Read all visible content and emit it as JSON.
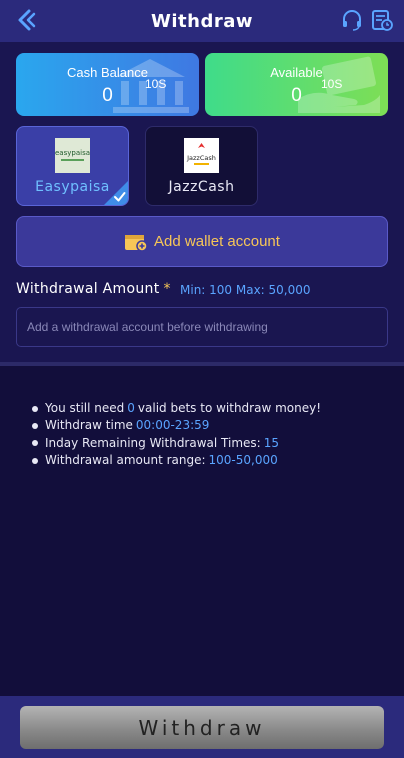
{
  "header": {
    "title": "Withdraw",
    "back_icon": "back-chevron-icon",
    "support_icon": "headset-icon",
    "records_icon": "records-icon"
  },
  "balances": {
    "cash": {
      "label": "Cash Balance",
      "value": "0",
      "amount": "10S"
    },
    "available": {
      "label": "Available",
      "value": "0",
      "amount": "10S"
    }
  },
  "methods": [
    {
      "name": "Easypaisa",
      "logo_text": "easypaisa",
      "selected": true
    },
    {
      "name": "JazzCash",
      "logo_text": "JazzCash",
      "selected": false
    }
  ],
  "add_wallet": {
    "label": "Add wallet account"
  },
  "amount": {
    "label": "Withdrawal Amount",
    "required_mark": "*",
    "range": "Min: 100 Max: 50,000",
    "placeholder": "Add a withdrawal account before withdrawing",
    "value": ""
  },
  "rules": [
    {
      "pre": "You still need",
      "highlight": "0",
      "post": "valid bets to withdraw money!"
    },
    {
      "pre": "Withdraw time",
      "highlight": "00:00-23:59",
      "post": ""
    },
    {
      "pre": "Inday Remaining Withdrawal Times:",
      "highlight": "15",
      "post": ""
    },
    {
      "pre": "Withdrawal amount range:",
      "highlight": "100-50,000",
      "post": ""
    }
  ],
  "footer": {
    "withdraw_label": "Withdraw"
  },
  "colors": {
    "accent_yellow": "#f7c657",
    "accent_blue": "#5aa4ff",
    "header_bg": "#2b2a7c",
    "page_bg": "#1a1651"
  }
}
